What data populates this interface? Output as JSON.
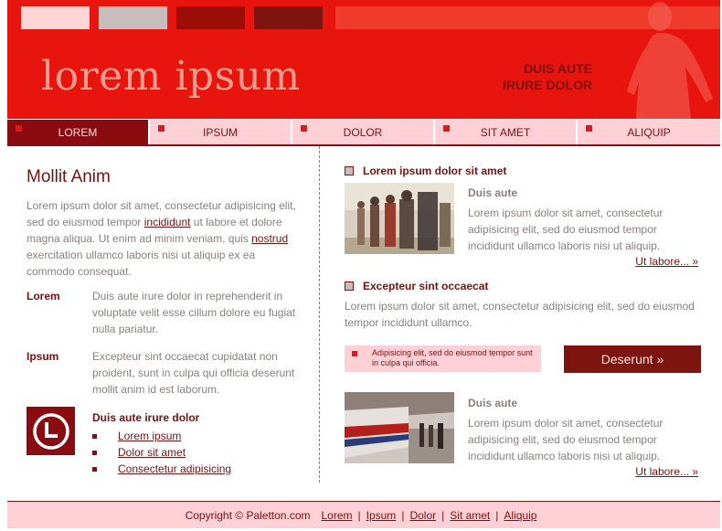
{
  "header": {
    "site_title": "lorem ipsum",
    "tagline_line1": "DUIS AUTE",
    "tagline_line2": "IRURE DOLOR"
  },
  "colors": {
    "primary": "#e8140e",
    "dark_red": "#8a0c10",
    "pink": "#ffd1d6",
    "text_gray": "#8a7f7f"
  },
  "nav": {
    "items": [
      {
        "label": "LOREM",
        "active": true
      },
      {
        "label": "IPSUM",
        "active": false
      },
      {
        "label": "DOLOR",
        "active": false
      },
      {
        "label": "SIT AMET",
        "active": false
      },
      {
        "label": "ALIQUIP",
        "active": false
      }
    ]
  },
  "left": {
    "heading": "Mollit Anim",
    "intro_part1": "Lorem ipsum dolor sit amet, consectetur adipisicing elit, sed do eiusmod tempor ",
    "intro_link1": "incididunt",
    "intro_part2": " ut labore et dolore magna aliqua. Ut enim ad minim veniam, quis ",
    "intro_link2": "nostrud",
    "intro_part3": " exercitation ullamco laboris nisi ut aliquip ex ea commodo consequat.",
    "defs": [
      {
        "term": "Lorem",
        "desc": "Duis aute irure dolor in reprehenderit in voluptate velit esse cillum dolore eu fugiat nulla pariatur."
      },
      {
        "term": "Ipsum",
        "desc": "Excepteur sint occaecat cupidatat non proident, sunt in culpa qui officia deserunt mollit anim id est laborum."
      }
    ],
    "list_title": "Duis aute irure dolor",
    "list_items": [
      "Lorem ipsum",
      "Dolor sit amet",
      "Consectetur adipisicing"
    ]
  },
  "right": {
    "section1_heading": "Lorem ipsum dolor sit amet",
    "media1_title": "Duis aute",
    "media1_body": "Lorem ipsum dolor sit amet, consectetur adipisicing elit, sed do eiusmod tempor incididunt ullamco laboris nisi ut aliquip.",
    "more1": "Ut labore... »",
    "section2_heading": "Excepteur sint occaecat",
    "section2_body": "Lorem ipsum dolor sit amet, consectetur adipisicing elit, sed do eiusmod tempor incididunt ullamco.",
    "note": "Adipisicing elit, sed do eiusmod tempor sunt in culpa qui officia.",
    "cta_label": "Deserunt »",
    "media2_title": "Duis aute",
    "media2_body": "Lorem ipsum dolor sit amet, consectetur adipisicing elit, sed do eiusmod tempor incididunt ullamco laboris nisi ut aliquip.",
    "more2": "Ut labore... »"
  },
  "footer": {
    "copyright": "Copyright © Paletton.com",
    "links": [
      "Lorem",
      "Ipsum",
      "Dolor",
      "Sit amet",
      "Aliquip"
    ]
  }
}
